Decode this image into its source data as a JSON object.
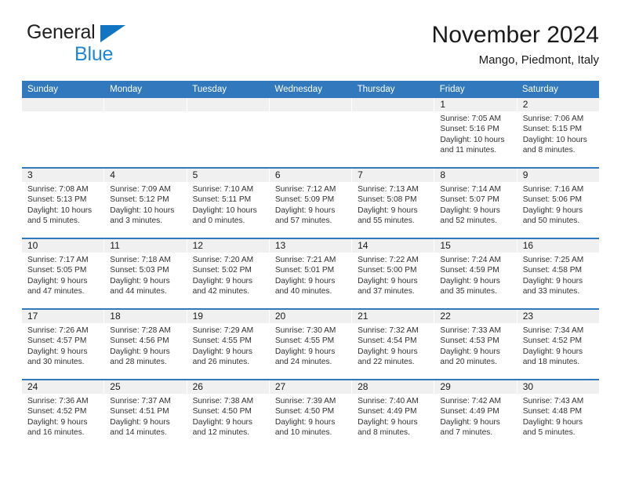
{
  "brand": {
    "line1": "General",
    "line2": "Blue",
    "triangle_color": "#1275c4",
    "blue_color": "#1f86d8"
  },
  "header": {
    "title": "November 2024",
    "subtitle": "Mango, Piedmont, Italy"
  },
  "theme": {
    "header_blue": "#3179bc",
    "daynum_band": "#f0f0f0",
    "text": "#313131"
  },
  "calendar": {
    "weekday_headers": [
      "Sunday",
      "Monday",
      "Tuesday",
      "Wednesday",
      "Thursday",
      "Friday",
      "Saturday"
    ],
    "weeks": [
      [
        {
          "empty": true
        },
        {
          "empty": true
        },
        {
          "empty": true
        },
        {
          "empty": true
        },
        {
          "empty": true
        },
        {
          "day": "1",
          "sunrise": "Sunrise: 7:05 AM",
          "sunset": "Sunset: 5:16 PM",
          "daylight1": "Daylight: 10 hours",
          "daylight2": "and 11 minutes."
        },
        {
          "day": "2",
          "sunrise": "Sunrise: 7:06 AM",
          "sunset": "Sunset: 5:15 PM",
          "daylight1": "Daylight: 10 hours",
          "daylight2": "and 8 minutes."
        }
      ],
      [
        {
          "day": "3",
          "sunrise": "Sunrise: 7:08 AM",
          "sunset": "Sunset: 5:13 PM",
          "daylight1": "Daylight: 10 hours",
          "daylight2": "and 5 minutes."
        },
        {
          "day": "4",
          "sunrise": "Sunrise: 7:09 AM",
          "sunset": "Sunset: 5:12 PM",
          "daylight1": "Daylight: 10 hours",
          "daylight2": "and 3 minutes."
        },
        {
          "day": "5",
          "sunrise": "Sunrise: 7:10 AM",
          "sunset": "Sunset: 5:11 PM",
          "daylight1": "Daylight: 10 hours",
          "daylight2": "and 0 minutes."
        },
        {
          "day": "6",
          "sunrise": "Sunrise: 7:12 AM",
          "sunset": "Sunset: 5:09 PM",
          "daylight1": "Daylight: 9 hours",
          "daylight2": "and 57 minutes."
        },
        {
          "day": "7",
          "sunrise": "Sunrise: 7:13 AM",
          "sunset": "Sunset: 5:08 PM",
          "daylight1": "Daylight: 9 hours",
          "daylight2": "and 55 minutes."
        },
        {
          "day": "8",
          "sunrise": "Sunrise: 7:14 AM",
          "sunset": "Sunset: 5:07 PM",
          "daylight1": "Daylight: 9 hours",
          "daylight2": "and 52 minutes."
        },
        {
          "day": "9",
          "sunrise": "Sunrise: 7:16 AM",
          "sunset": "Sunset: 5:06 PM",
          "daylight1": "Daylight: 9 hours",
          "daylight2": "and 50 minutes."
        }
      ],
      [
        {
          "day": "10",
          "sunrise": "Sunrise: 7:17 AM",
          "sunset": "Sunset: 5:05 PM",
          "daylight1": "Daylight: 9 hours",
          "daylight2": "and 47 minutes."
        },
        {
          "day": "11",
          "sunrise": "Sunrise: 7:18 AM",
          "sunset": "Sunset: 5:03 PM",
          "daylight1": "Daylight: 9 hours",
          "daylight2": "and 44 minutes."
        },
        {
          "day": "12",
          "sunrise": "Sunrise: 7:20 AM",
          "sunset": "Sunset: 5:02 PM",
          "daylight1": "Daylight: 9 hours",
          "daylight2": "and 42 minutes."
        },
        {
          "day": "13",
          "sunrise": "Sunrise: 7:21 AM",
          "sunset": "Sunset: 5:01 PM",
          "daylight1": "Daylight: 9 hours",
          "daylight2": "and 40 minutes."
        },
        {
          "day": "14",
          "sunrise": "Sunrise: 7:22 AM",
          "sunset": "Sunset: 5:00 PM",
          "daylight1": "Daylight: 9 hours",
          "daylight2": "and 37 minutes."
        },
        {
          "day": "15",
          "sunrise": "Sunrise: 7:24 AM",
          "sunset": "Sunset: 4:59 PM",
          "daylight1": "Daylight: 9 hours",
          "daylight2": "and 35 minutes."
        },
        {
          "day": "16",
          "sunrise": "Sunrise: 7:25 AM",
          "sunset": "Sunset: 4:58 PM",
          "daylight1": "Daylight: 9 hours",
          "daylight2": "and 33 minutes."
        }
      ],
      [
        {
          "day": "17",
          "sunrise": "Sunrise: 7:26 AM",
          "sunset": "Sunset: 4:57 PM",
          "daylight1": "Daylight: 9 hours",
          "daylight2": "and 30 minutes."
        },
        {
          "day": "18",
          "sunrise": "Sunrise: 7:28 AM",
          "sunset": "Sunset: 4:56 PM",
          "daylight1": "Daylight: 9 hours",
          "daylight2": "and 28 minutes."
        },
        {
          "day": "19",
          "sunrise": "Sunrise: 7:29 AM",
          "sunset": "Sunset: 4:55 PM",
          "daylight1": "Daylight: 9 hours",
          "daylight2": "and 26 minutes."
        },
        {
          "day": "20",
          "sunrise": "Sunrise: 7:30 AM",
          "sunset": "Sunset: 4:55 PM",
          "daylight1": "Daylight: 9 hours",
          "daylight2": "and 24 minutes."
        },
        {
          "day": "21",
          "sunrise": "Sunrise: 7:32 AM",
          "sunset": "Sunset: 4:54 PM",
          "daylight1": "Daylight: 9 hours",
          "daylight2": "and 22 minutes."
        },
        {
          "day": "22",
          "sunrise": "Sunrise: 7:33 AM",
          "sunset": "Sunset: 4:53 PM",
          "daylight1": "Daylight: 9 hours",
          "daylight2": "and 20 minutes."
        },
        {
          "day": "23",
          "sunrise": "Sunrise: 7:34 AM",
          "sunset": "Sunset: 4:52 PM",
          "daylight1": "Daylight: 9 hours",
          "daylight2": "and 18 minutes."
        }
      ],
      [
        {
          "day": "24",
          "sunrise": "Sunrise: 7:36 AM",
          "sunset": "Sunset: 4:52 PM",
          "daylight1": "Daylight: 9 hours",
          "daylight2": "and 16 minutes."
        },
        {
          "day": "25",
          "sunrise": "Sunrise: 7:37 AM",
          "sunset": "Sunset: 4:51 PM",
          "daylight1": "Daylight: 9 hours",
          "daylight2": "and 14 minutes."
        },
        {
          "day": "26",
          "sunrise": "Sunrise: 7:38 AM",
          "sunset": "Sunset: 4:50 PM",
          "daylight1": "Daylight: 9 hours",
          "daylight2": "and 12 minutes."
        },
        {
          "day": "27",
          "sunrise": "Sunrise: 7:39 AM",
          "sunset": "Sunset: 4:50 PM",
          "daylight1": "Daylight: 9 hours",
          "daylight2": "and 10 minutes."
        },
        {
          "day": "28",
          "sunrise": "Sunrise: 7:40 AM",
          "sunset": "Sunset: 4:49 PM",
          "daylight1": "Daylight: 9 hours",
          "daylight2": "and 8 minutes."
        },
        {
          "day": "29",
          "sunrise": "Sunrise: 7:42 AM",
          "sunset": "Sunset: 4:49 PM",
          "daylight1": "Daylight: 9 hours",
          "daylight2": "and 7 minutes."
        },
        {
          "day": "30",
          "sunrise": "Sunrise: 7:43 AM",
          "sunset": "Sunset: 4:48 PM",
          "daylight1": "Daylight: 9 hours",
          "daylight2": "and 5 minutes."
        }
      ]
    ]
  }
}
